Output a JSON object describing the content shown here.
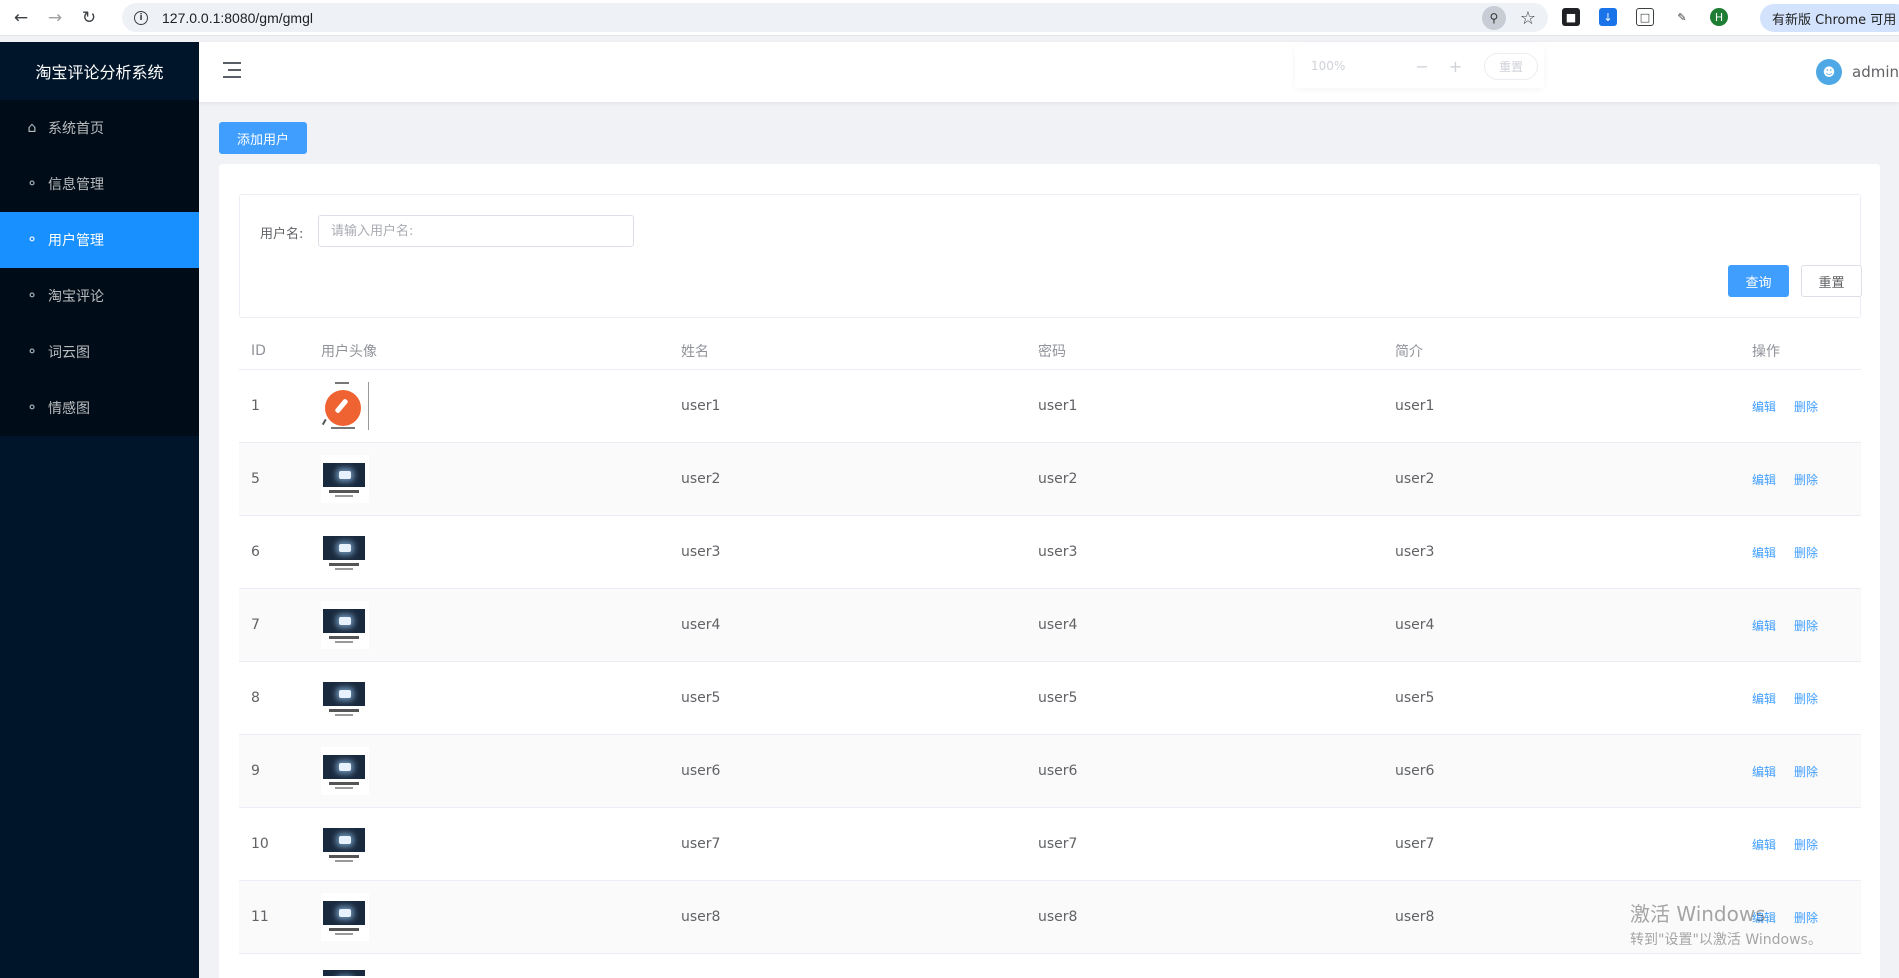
{
  "browser": {
    "url": "127.0.0.1:8080/gm/gmgl",
    "update_label": "有新版 Chrome 可用"
  },
  "sidebar": {
    "title": "淘宝评论分析系统",
    "items": [
      {
        "label": "系统首页",
        "icon": "home-icon",
        "active": false
      },
      {
        "label": "信息管理",
        "icon": "user-icon",
        "active": false
      },
      {
        "label": "用户管理",
        "icon": "user-icon",
        "active": true
      },
      {
        "label": "淘宝评论",
        "icon": "user-icon",
        "active": false
      },
      {
        "label": "词云图",
        "icon": "user-icon",
        "active": false
      },
      {
        "label": "情感图",
        "icon": "user-icon",
        "active": false
      }
    ]
  },
  "header": {
    "username": "admin",
    "zoom_value": "100%",
    "zoom_minus": "−",
    "zoom_plus": "+",
    "zoom_reset": "重置"
  },
  "toolbar": {
    "add_user_label": "添加用户"
  },
  "search": {
    "label": "用户名:",
    "placeholder": "请输入用户名:",
    "query_label": "查询",
    "reset_label": "重置"
  },
  "table": {
    "columns": [
      "ID",
      "用户头像",
      "姓名",
      "密码",
      "简介",
      "操作"
    ],
    "edit_label": "编辑",
    "delete_label": "删除",
    "rows": [
      {
        "id": "1",
        "name": "user1",
        "password": "user1",
        "bio": "user1"
      },
      {
        "id": "5",
        "name": "user2",
        "password": "user2",
        "bio": "user2"
      },
      {
        "id": "6",
        "name": "user3",
        "password": "user3",
        "bio": "user3"
      },
      {
        "id": "7",
        "name": "user4",
        "password": "user4",
        "bio": "user4"
      },
      {
        "id": "8",
        "name": "user5",
        "password": "user5",
        "bio": "user5"
      },
      {
        "id": "9",
        "name": "user6",
        "password": "user6",
        "bio": "user6"
      },
      {
        "id": "10",
        "name": "user7",
        "password": "user7",
        "bio": "user7"
      },
      {
        "id": "11",
        "name": "user8",
        "password": "user8",
        "bio": "user8"
      }
    ]
  },
  "watermark": {
    "line1": "激活 Windows",
    "line2": "转到\"设置\"以激活 Windows。"
  }
}
